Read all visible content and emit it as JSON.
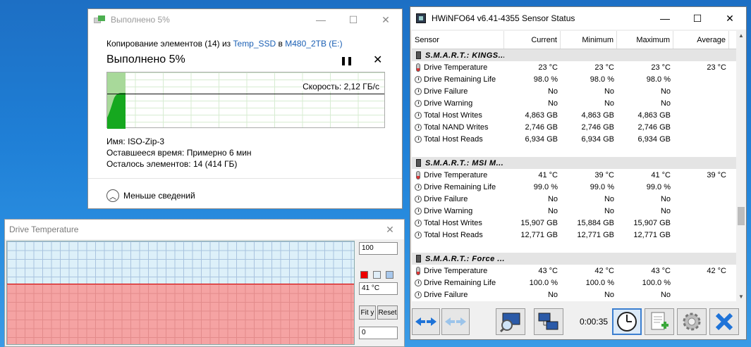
{
  "copy": {
    "title": "Выполнено 5%",
    "info_prefix": "Копирование элементов (14) из ",
    "src": "Temp_SSD",
    "info_mid": " в ",
    "dst": "M480_2TB (E:)",
    "heading": "Выполнено 5%",
    "pause": "❚❚",
    "close": "✕",
    "speed": "Скорость: 2,12 ГБ/с",
    "progress": 0.05,
    "name_label": "Имя:",
    "name_value": "ISO-Zip-3",
    "time_label": "Оставшееся время:",
    "time_value": "Примерно 6 мин",
    "items_label": "Осталось элементов:",
    "items_value": "14 (414 ГБ)",
    "less": "Меньше сведений",
    "colors": {
      "graph_fill": "#16a81f",
      "graph_done": "#a8d99a"
    }
  },
  "dtemp": {
    "title": "Drive Temperature",
    "close": "✕",
    "max": "100",
    "current": "41 °C",
    "min": "0",
    "fit_y": "Fit y",
    "reset": "Reset",
    "level": 0.41,
    "colors": {
      "line": "#dd0000",
      "swatch1": "#ee0000",
      "swatch2": "#e0eef8",
      "swatch3": "#a8c8ec"
    }
  },
  "hw": {
    "title": "HWiNFO64 v6.41-4355 Sensor Status",
    "min_btn": "—",
    "max_btn": "☐",
    "close_btn": "✕",
    "columns": [
      "Sensor",
      "Current",
      "Minimum",
      "Maximum",
      "Average"
    ],
    "groups": [
      {
        "name": "S.M.A.R.T.: KINGS...",
        "rows": [
          {
            "icon": "thermometer-icon",
            "label": "Drive Temperature",
            "cur": "23 °C",
            "min": "23 °C",
            "max": "23 °C",
            "avg": "23 °C"
          },
          {
            "icon": "clock-icon",
            "label": "Drive Remaining Life",
            "cur": "98.0 %",
            "min": "98.0 %",
            "max": "98.0 %",
            "avg": ""
          },
          {
            "icon": "clock-icon",
            "label": "Drive Failure",
            "cur": "No",
            "min": "No",
            "max": "No",
            "avg": ""
          },
          {
            "icon": "clock-icon",
            "label": "Drive Warning",
            "cur": "No",
            "min": "No",
            "max": "No",
            "avg": ""
          },
          {
            "icon": "clock-icon",
            "label": "Total Host Writes",
            "cur": "4,863 GB",
            "min": "4,863 GB",
            "max": "4,863 GB",
            "avg": ""
          },
          {
            "icon": "clock-icon",
            "label": "Total NAND Writes",
            "cur": "2,746 GB",
            "min": "2,746 GB",
            "max": "2,746 GB",
            "avg": ""
          },
          {
            "icon": "clock-icon",
            "label": "Total Host Reads",
            "cur": "6,934 GB",
            "min": "6,934 GB",
            "max": "6,934 GB",
            "avg": ""
          }
        ]
      },
      {
        "name": "S.M.A.R.T.: MSI M...",
        "rows": [
          {
            "icon": "thermometer-icon",
            "label": "Drive Temperature",
            "cur": "41 °C",
            "min": "39 °C",
            "max": "41 °C",
            "avg": "39 °C"
          },
          {
            "icon": "clock-icon",
            "label": "Drive Remaining Life",
            "cur": "99.0 %",
            "min": "99.0 %",
            "max": "99.0 %",
            "avg": ""
          },
          {
            "icon": "clock-icon",
            "label": "Drive Failure",
            "cur": "No",
            "min": "No",
            "max": "No",
            "avg": ""
          },
          {
            "icon": "clock-icon",
            "label": "Drive Warning",
            "cur": "No",
            "min": "No",
            "max": "No",
            "avg": ""
          },
          {
            "icon": "clock-icon",
            "label": "Total Host Writes",
            "cur": "15,907 GB",
            "min": "15,884 GB",
            "max": "15,907 GB",
            "avg": ""
          },
          {
            "icon": "clock-icon",
            "label": "Total Host Reads",
            "cur": "12,771 GB",
            "min": "12,771 GB",
            "max": "12,771 GB",
            "avg": ""
          }
        ]
      },
      {
        "name": "S.M.A.R.T.: Force ...",
        "rows": [
          {
            "icon": "thermometer-icon",
            "label": "Drive Temperature",
            "cur": "43 °C",
            "min": "42 °C",
            "max": "43 °C",
            "avg": "42 °C"
          },
          {
            "icon": "clock-icon",
            "label": "Drive Remaining Life",
            "cur": "100.0 %",
            "min": "100.0 %",
            "max": "100.0 %",
            "avg": ""
          },
          {
            "icon": "clock-icon",
            "label": "Drive Failure",
            "cur": "No",
            "min": "No",
            "max": "No",
            "avg": ""
          }
        ]
      }
    ],
    "timer": "0:00:35",
    "toolbar": [
      "arrows-icon",
      "arrows-disabled-icon",
      "monitor-search-icon",
      "network-icon",
      "clock-icon",
      "add-report-icon",
      "settings-gear-icon",
      "close-x-icon"
    ]
  }
}
